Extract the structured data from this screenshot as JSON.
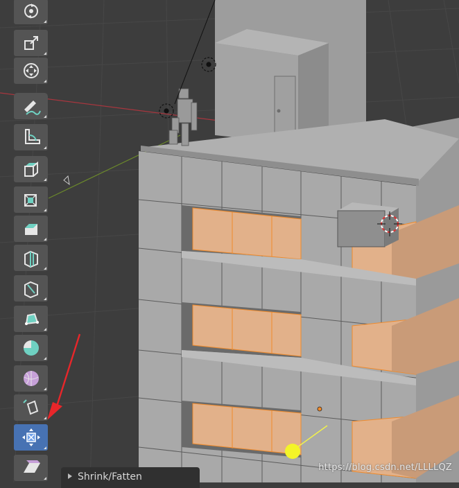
{
  "viewport": {
    "name": "3D Viewport"
  },
  "toolbar": {
    "tools": [
      {
        "name": "rotate-tool",
        "icon": "rotate-icon"
      },
      {
        "name": "scale-tool",
        "icon": "scale-icon"
      },
      {
        "name": "transform-tool",
        "icon": "transform-icon"
      },
      {
        "name": "annotate-tool",
        "icon": "annotate-icon"
      },
      {
        "name": "measure-tool",
        "icon": "measure-icon"
      },
      {
        "name": "extrude-region-tool",
        "icon": "extrude-region-icon"
      },
      {
        "name": "inset-faces-tool",
        "icon": "inset-faces-icon"
      },
      {
        "name": "bevel-tool",
        "icon": "bevel-icon"
      },
      {
        "name": "loop-cut-tool",
        "icon": "loop-cut-icon"
      },
      {
        "name": "knife-tool",
        "icon": "knife-icon"
      },
      {
        "name": "poly-build-tool",
        "icon": "poly-build-icon"
      },
      {
        "name": "spin-tool",
        "icon": "spin-icon"
      },
      {
        "name": "smooth-tool",
        "icon": "smooth-icon"
      },
      {
        "name": "edge-slide-tool",
        "icon": "edge-slide-icon"
      },
      {
        "name": "shrink-fatten-tool",
        "icon": "shrink-fatten-icon",
        "active": true
      },
      {
        "name": "shear-tool",
        "icon": "shear-icon"
      }
    ]
  },
  "operator_panel": {
    "label": "Shrink/Fatten"
  },
  "watermark": {
    "text": "https://blog.csdn.net/LLLLQZ"
  },
  "colors": {
    "viewport_bg": "#3d3d3d",
    "grid": "#474747",
    "x_axis": "#a8363e",
    "y_axis": "#6c8a2b",
    "mesh_face": "#a9a9a9",
    "selected_face": "#e2b18a",
    "selected_edge": "#f08a2a",
    "active_tool": "#4772b3",
    "tool_bg": "#545454",
    "annotation_arrow": "#e8262a"
  }
}
